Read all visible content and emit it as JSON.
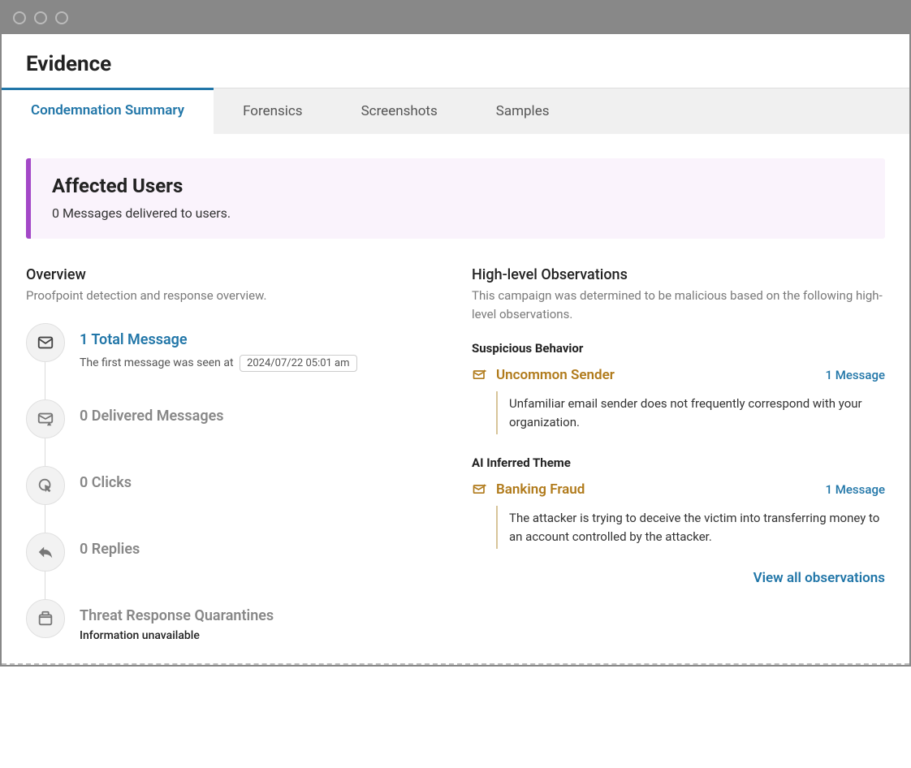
{
  "page": {
    "title": "Evidence"
  },
  "tabs": [
    {
      "label": "Condemnation Summary",
      "active": true
    },
    {
      "label": "Forensics",
      "active": false
    },
    {
      "label": "Screenshots",
      "active": false
    },
    {
      "label": "Samples",
      "active": false
    }
  ],
  "affected_users": {
    "title": "Affected Users",
    "subtitle": "0 Messages delivered to users."
  },
  "overview": {
    "title": "Overview",
    "subtitle": "Proofpoint detection and response overview.",
    "items": [
      {
        "icon": "mail-icon",
        "label": "1 Total Message",
        "primary": true,
        "sub_prefix": "The first message was seen at",
        "timestamp": "2024/07/22 05:01 am"
      },
      {
        "icon": "mail-alert-icon",
        "label": "0 Delivered Messages"
      },
      {
        "icon": "click-icon",
        "label": "0 Clicks"
      },
      {
        "icon": "reply-icon",
        "label": "0 Replies"
      },
      {
        "icon": "quarantine-icon",
        "label": "Threat Response Quarantines",
        "note": "Information unavailable"
      }
    ]
  },
  "observations": {
    "title": "High-level Observations",
    "subtitle": "This campaign was determined to be malicious based on the following high-level observations.",
    "groups": [
      {
        "title": "Suspicious Behavior",
        "items": [
          {
            "name": "Uncommon Sender",
            "count_label": "1 Message",
            "description": "Unfamiliar email sender does not frequently correspond with your organization."
          }
        ]
      },
      {
        "title": "AI Inferred Theme",
        "items": [
          {
            "name": "Banking Fraud",
            "count_label": "1 Message",
            "description": "The attacker is trying to deceive the victim into transferring money to an account controlled by the attacker."
          }
        ]
      }
    ],
    "view_all_label": "View all observations"
  },
  "colors": {
    "accent": "#2176a8",
    "warning": "#b07a1a",
    "purple": "#a348c7"
  }
}
